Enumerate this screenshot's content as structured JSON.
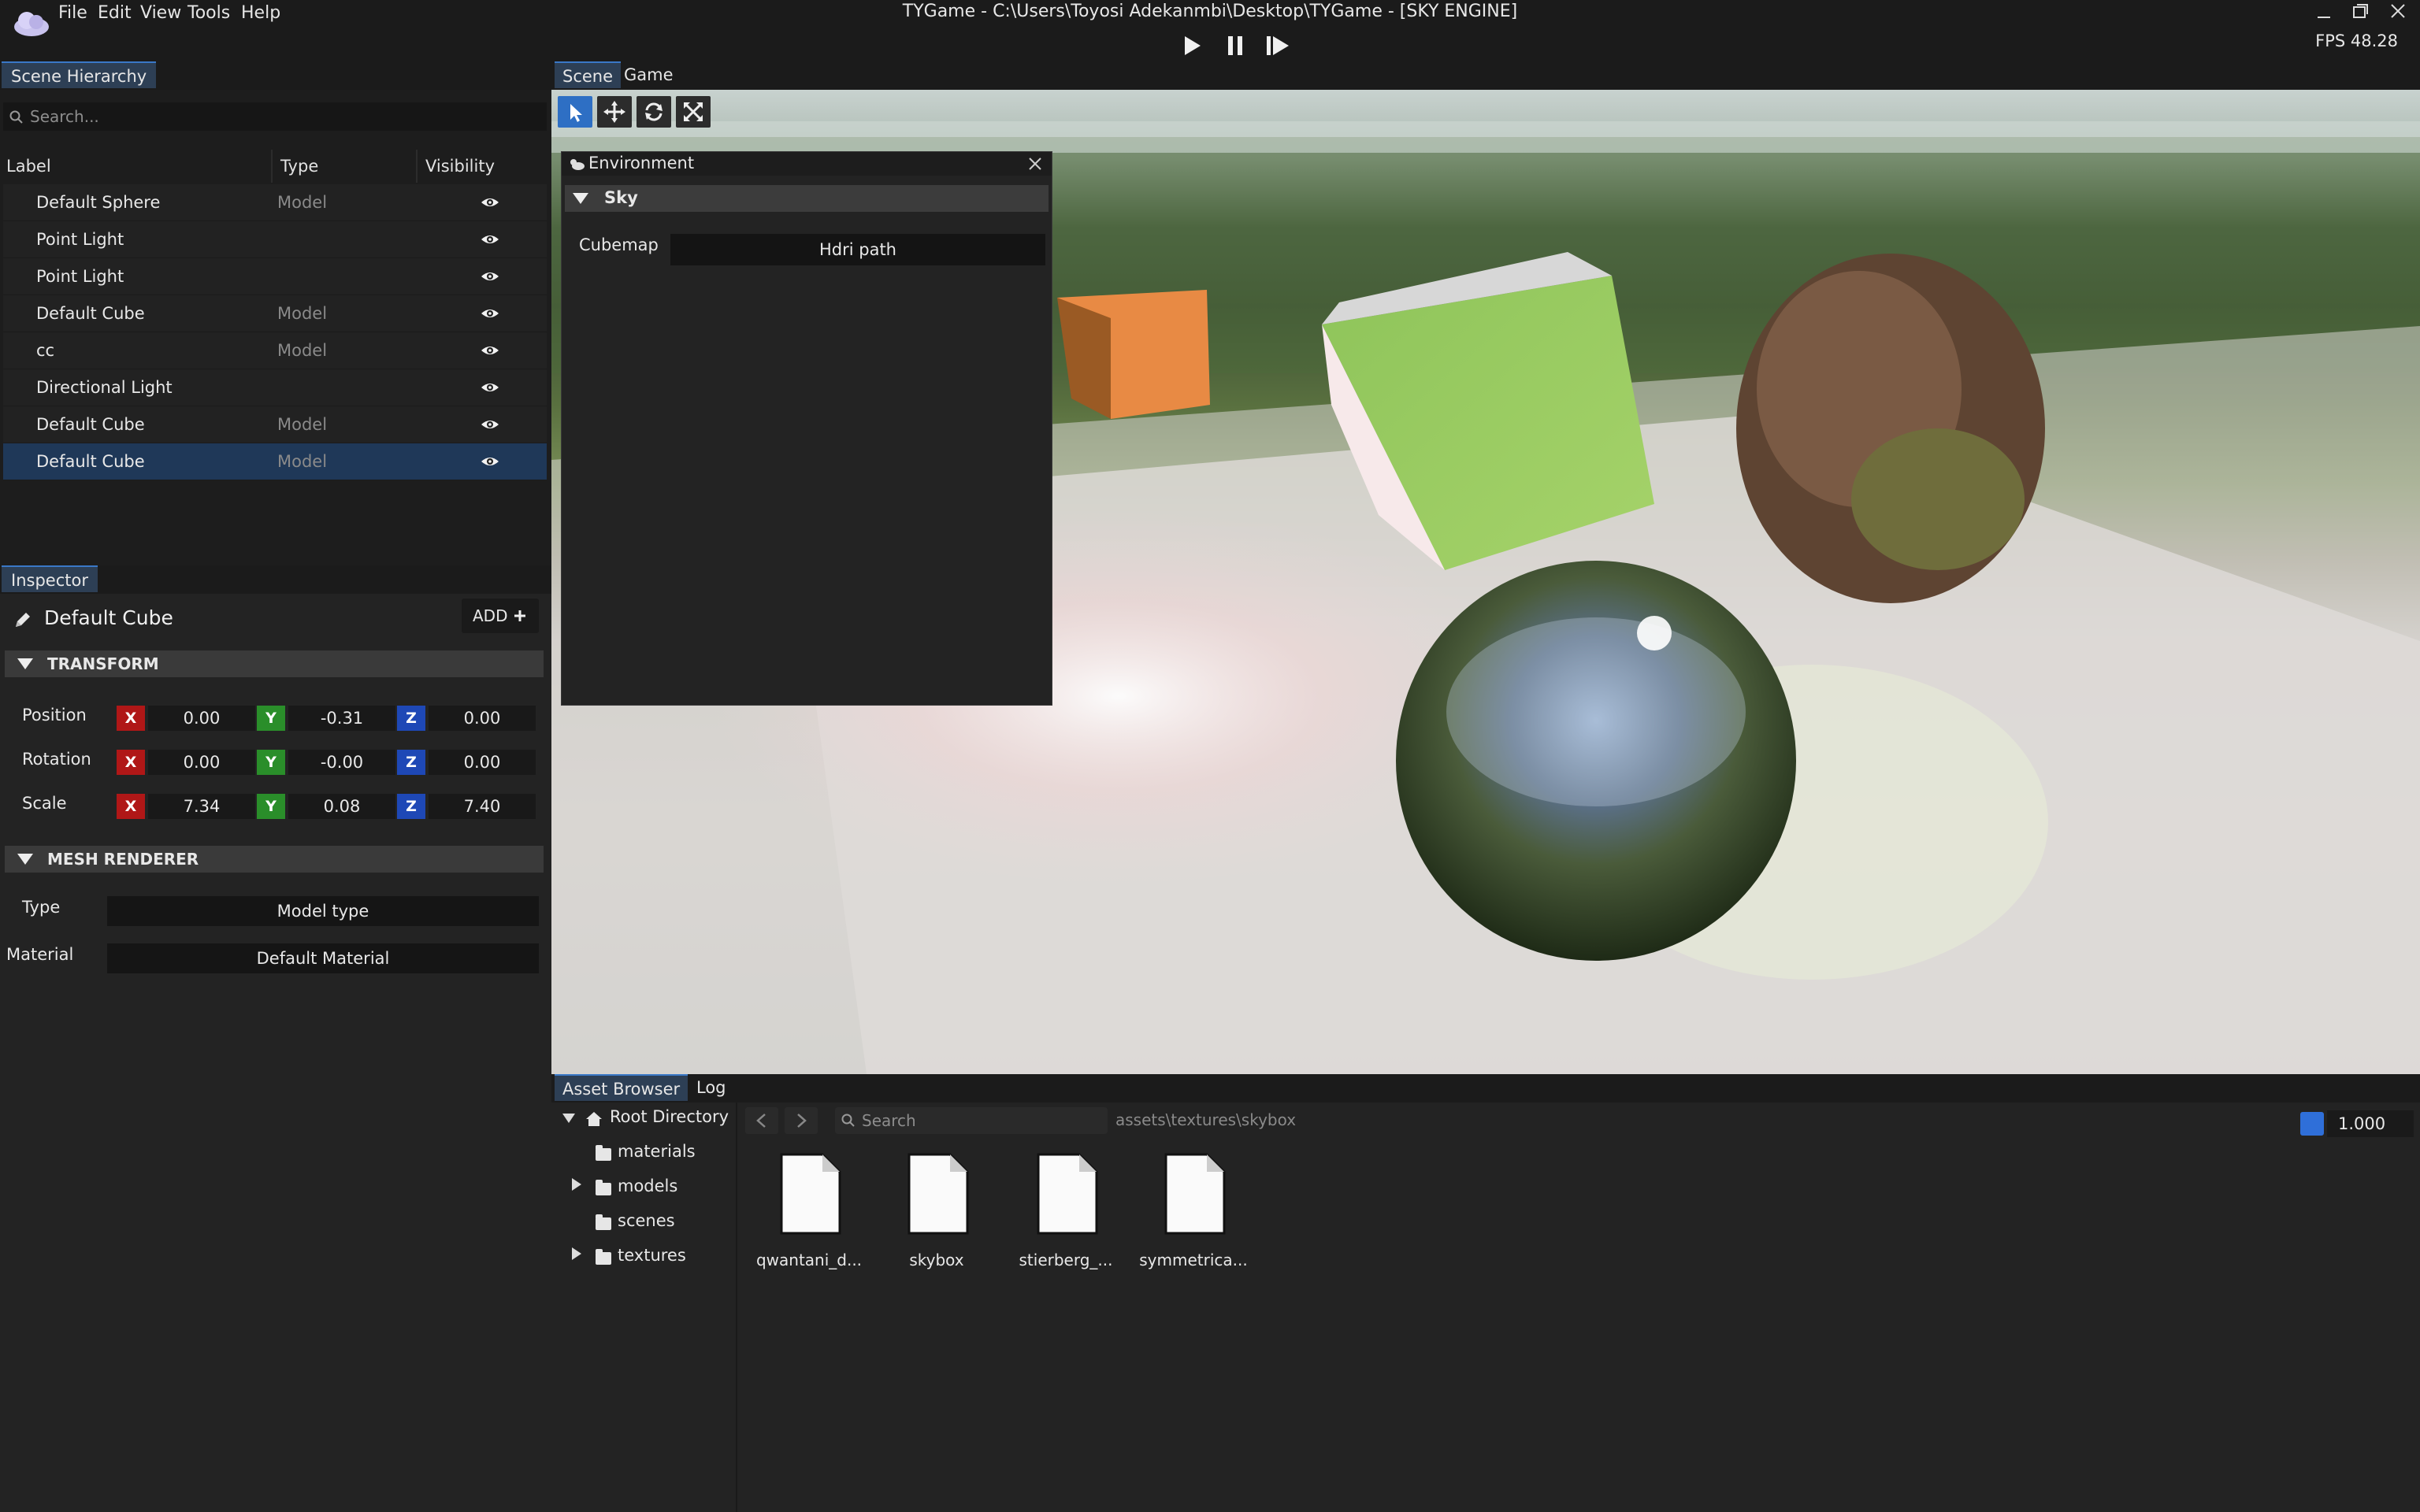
{
  "menu": [
    "File",
    "Edit",
    "View",
    "Tools",
    "Help"
  ],
  "window_title": "TYGame - C:\\Users\\Toyosi Adekanmbi\\Desktop\\TYGame - [SKY ENGINE]",
  "fps": "FPS 48.28",
  "hierarchy": {
    "tab": "Scene Hierarchy",
    "search_placeholder": "Search...",
    "columns": [
      "Label",
      "Type",
      "Visibility"
    ],
    "rows": [
      {
        "label": "Default Sphere",
        "type": "Model"
      },
      {
        "label": "Point Light",
        "type": ""
      },
      {
        "label": "Point Light",
        "type": ""
      },
      {
        "label": "Default Cube",
        "type": "Model"
      },
      {
        "label": "cc",
        "type": "Model"
      },
      {
        "label": "Directional Light",
        "type": ""
      },
      {
        "label": "Default Cube",
        "type": "Model"
      },
      {
        "label": "Default Cube",
        "type": "Model",
        "selected": true
      }
    ]
  },
  "inspector": {
    "tab": "Inspector",
    "object_name": "Default Cube",
    "add_label": "ADD",
    "transform_title": "TRANSFORM",
    "position": {
      "label": "Position",
      "x": "0.00",
      "y": "-0.31",
      "z": "0.00"
    },
    "rotation": {
      "label": "Rotation",
      "x": "0.00",
      "y": "-0.00",
      "z": "0.00"
    },
    "scale": {
      "label": "Scale",
      "x": "7.34",
      "y": "0.08",
      "z": "7.40"
    },
    "mesh_title": "MESH RENDERER",
    "type_label": "Type",
    "type_value": "Model type",
    "material_label": "Material",
    "material_value": "Default Material",
    "axis": {
      "x": "X",
      "y": "Y",
      "z": "Z"
    }
  },
  "scene": {
    "tabs": [
      "Scene",
      "Game"
    ],
    "environment": {
      "title": "Environment",
      "section": "Sky",
      "cubemap_label": "Cubemap",
      "cubemap_value": "Hdri path"
    }
  },
  "assets": {
    "tabs": [
      "Asset Browser",
      "Log"
    ],
    "tree_root": "Root Directory",
    "tree": [
      "materials",
      "models",
      "scenes",
      "textures"
    ],
    "search_placeholder": "Search",
    "path": "assets\\textures\\skybox",
    "files": [
      "qwantani_d...",
      "skybox",
      "stierberg_...",
      "symmetrica..."
    ],
    "zoom": "1.000"
  },
  "colors": {
    "accent": "#2e6fc4",
    "selection": "#1f3858",
    "axis_x": "#b01717",
    "axis_y": "#2a8e2a",
    "axis_z": "#1e48b6"
  }
}
